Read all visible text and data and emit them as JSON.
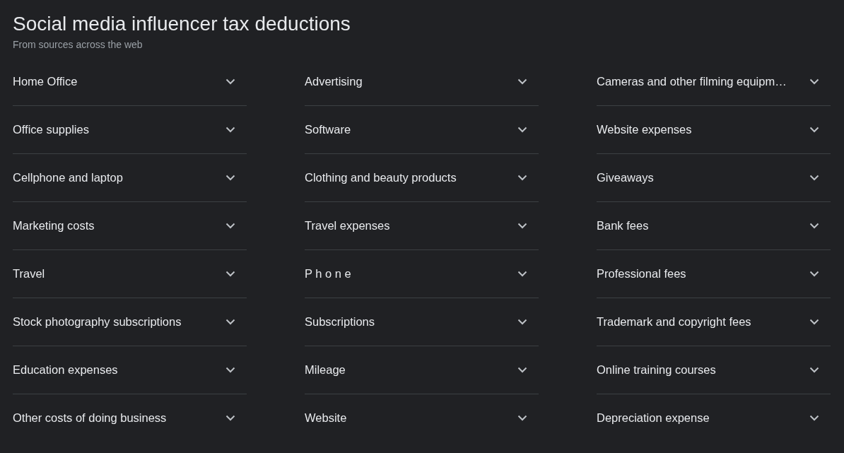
{
  "title": "Social media influencer tax deductions",
  "subtitle": "From sources across the web",
  "columns": [
    [
      {
        "label": "Home Office",
        "expanded": false
      },
      {
        "label": "Office supplies",
        "expanded": false
      },
      {
        "label": "Cellphone and laptop",
        "expanded": false
      },
      {
        "label": "Marketing costs",
        "expanded": false
      },
      {
        "label": "Travel",
        "expanded": false
      },
      {
        "label": "Stock photography subscriptions",
        "expanded": false
      },
      {
        "label": "Education expenses",
        "expanded": false
      },
      {
        "label": "Other costs of doing business",
        "expanded": false
      }
    ],
    [
      {
        "label": "Advertising",
        "expanded": false
      },
      {
        "label": "Software",
        "expanded": false
      },
      {
        "label": "Clothing and beauty products",
        "expanded": false
      },
      {
        "label": "Travel expenses",
        "expanded": false
      },
      {
        "label": "P h o n e",
        "expanded": false
      },
      {
        "label": "Subscriptions",
        "expanded": false
      },
      {
        "label": "Mileage",
        "expanded": false
      },
      {
        "label": "Website",
        "expanded": false
      }
    ],
    [
      {
        "label": "Cameras and other filming equipm…",
        "expanded": false
      },
      {
        "label": "Website expenses",
        "expanded": false
      },
      {
        "label": "Giveaways",
        "expanded": false
      },
      {
        "label": "Bank fees",
        "expanded": false
      },
      {
        "label": "Professional fees",
        "expanded": false
      },
      {
        "label": "Trademark and copyright fees",
        "expanded": false
      },
      {
        "label": "Online training courses",
        "expanded": false
      },
      {
        "label": "Depreciation expense",
        "expanded": false
      }
    ]
  ]
}
